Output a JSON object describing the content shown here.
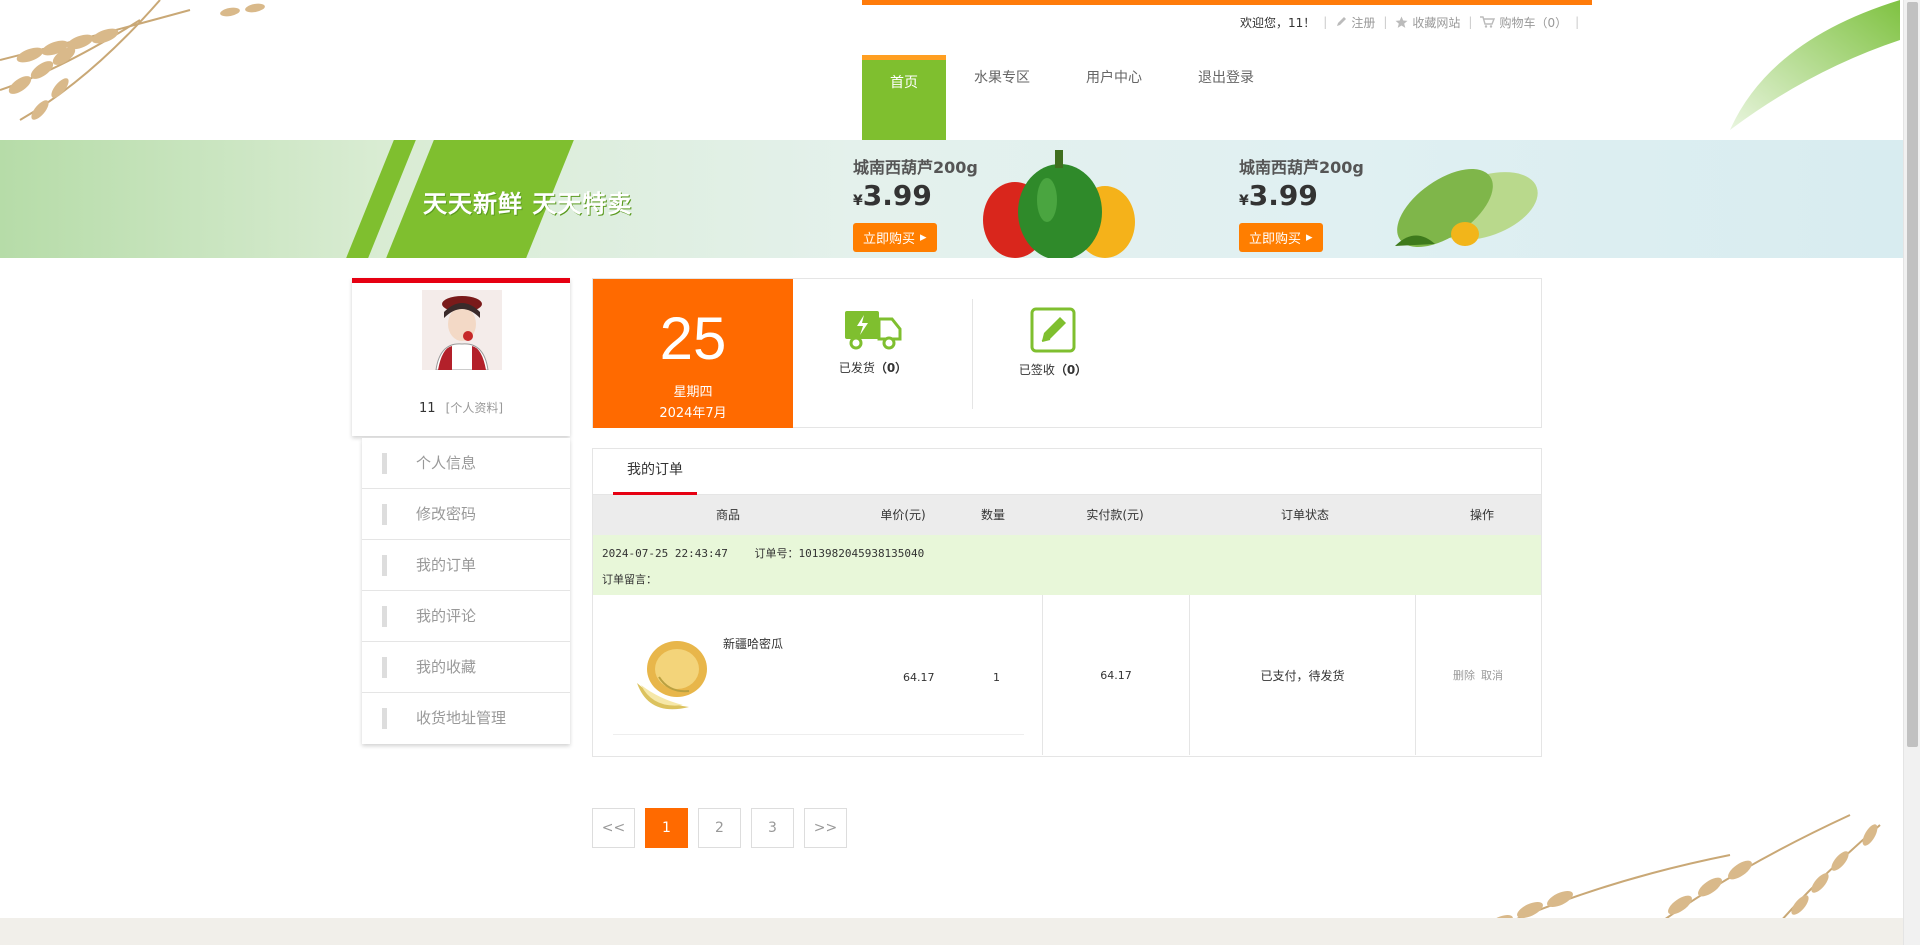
{
  "topbar": {
    "welcome": "欢迎您，11！",
    "register": "注册",
    "favorite_site": "收藏网站",
    "cart": "购物车（0）"
  },
  "nav": {
    "items": [
      {
        "label": "首页",
        "active": true
      },
      {
        "label": "水果专区"
      },
      {
        "label": "用户中心"
      },
      {
        "label": "退出登录"
      }
    ]
  },
  "banner": {
    "slogan": "天天新鲜  天天特卖",
    "promos": [
      {
        "name": "城南西葫芦200g",
        "currency": "¥",
        "price": "3.99",
        "button": "立即购买"
      },
      {
        "name": "城南西葫芦200g",
        "currency": "¥",
        "price": "3.99",
        "button": "立即购买"
      }
    ]
  },
  "profile": {
    "username": "11",
    "profile_link": "[个人资料]"
  },
  "menu": {
    "items": [
      "个人信息",
      "修改密码",
      "我的订单",
      "我的评论",
      "我的收藏",
      "收货地址管理"
    ]
  },
  "date": {
    "day": "25",
    "weekday": "星期四",
    "year_month": "2024年7月"
  },
  "stats": {
    "shipped_label": "已发货",
    "shipped_count": "（0）",
    "received_label": "已签收",
    "received_count": "（0）"
  },
  "orders": {
    "tab": "我的订单",
    "columns": [
      "商品",
      "单价(元)",
      "数量",
      "实付款(元)",
      "订单状态",
      "操作"
    ],
    "list": [
      {
        "time": "2024-07-25 22:43:47",
        "order_no_label": "订单号：",
        "order_no": "1013982045938135040",
        "remark_label": "订单留言：",
        "product": "新疆哈密瓜",
        "unit_price": "64.17",
        "quantity": "1",
        "paid": "64.17",
        "status": "已支付，待发货",
        "action_delete": "删除",
        "action_cancel": "取消"
      }
    ]
  },
  "pager": {
    "prev": "<<",
    "pages": [
      "1",
      "2",
      "3"
    ],
    "current": "1",
    "next": ">>"
  },
  "colors": {
    "accent_orange": "#ff6a00",
    "nav_green": "#7fbf2f",
    "tab_red": "#e60012"
  }
}
